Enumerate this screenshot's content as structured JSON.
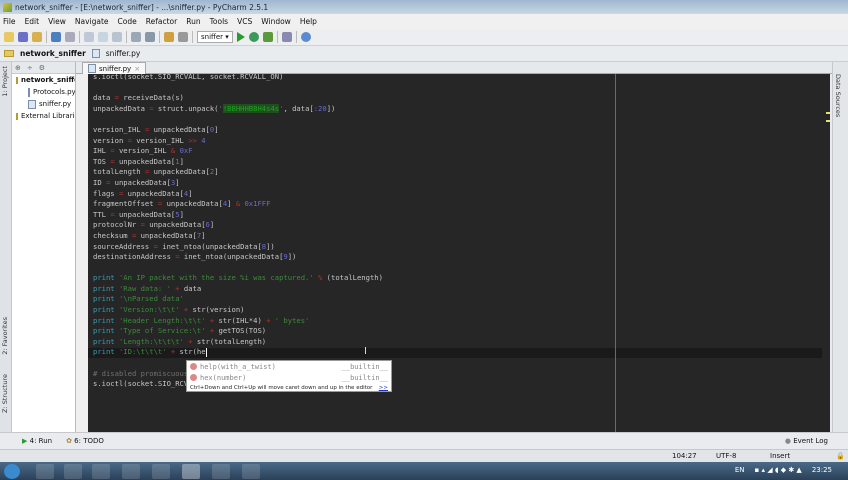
{
  "window": {
    "title": "network_sniffer - [E:\\network_sniffer] - ...\\sniffer.py - PyCharm 2.5.1"
  },
  "menu": [
    "File",
    "Edit",
    "View",
    "Navigate",
    "Code",
    "Refactor",
    "Run",
    "Tools",
    "VCS",
    "Window",
    "Help"
  ],
  "toolbar": {
    "run_config": "sniffer ▾"
  },
  "navbar": {
    "project": "network_sniffer",
    "file": "sniffer.py"
  },
  "left_tabs": {
    "project": "1: Project",
    "favorites": "2: Favorites",
    "structure": "Z: Structure"
  },
  "right_tabs": {
    "data_sources": "Data Sources"
  },
  "project_tree": [
    {
      "label": "network_sniffer",
      "indent": 0
    },
    {
      "label": "Protocols.py",
      "indent": 1
    },
    {
      "label": "sniffer.py",
      "indent": 1
    },
    {
      "label": "External Libraries",
      "indent": 0
    }
  ],
  "editor": {
    "tab": "sniffer.py",
    "current_line": 26,
    "code": [
      [
        [
          "s.ioctl(socket.SIO_RCVALL, socket.RCVALL_ON)",
          ""
        ]
      ],
      [],
      [
        [
          "data ",
          ""
        ],
        [
          "=",
          "op"
        ],
        [
          " receiveData(s)",
          ""
        ]
      ],
      [
        [
          "unpackedData ",
          ""
        ],
        [
          "=",
          "op"
        ],
        [
          " struct.unpack(",
          ""
        ],
        [
          "'",
          "str"
        ],
        [
          "!BBHHHBBH4s4s",
          "fmt"
        ],
        [
          "'",
          "str"
        ],
        [
          ", data[",
          ""
        ],
        [
          ":20",
          "num"
        ],
        [
          "])",
          ""
        ]
      ],
      [],
      [
        [
          "version_IHL ",
          ""
        ],
        [
          "=",
          "op"
        ],
        [
          " unpackedData[",
          ""
        ],
        [
          "0",
          "num"
        ],
        [
          "]",
          ""
        ]
      ],
      [
        [
          "version ",
          ""
        ],
        [
          "=",
          "op"
        ],
        [
          " version_IHL ",
          ""
        ],
        [
          ">>",
          "op"
        ],
        [
          " ",
          ""
        ],
        [
          "4",
          "num"
        ]
      ],
      [
        [
          "IHL ",
          ""
        ],
        [
          "=",
          "op"
        ],
        [
          " version_IHL ",
          ""
        ],
        [
          "&",
          "op"
        ],
        [
          " ",
          ""
        ],
        [
          "0xF",
          "num"
        ]
      ],
      [
        [
          "TOS ",
          ""
        ],
        [
          "=",
          "op"
        ],
        [
          " unpackedData[",
          ""
        ],
        [
          "1",
          "num"
        ],
        [
          "]",
          ""
        ]
      ],
      [
        [
          "totalLength ",
          ""
        ],
        [
          "=",
          "op"
        ],
        [
          " unpackedData[",
          ""
        ],
        [
          "2",
          "num"
        ],
        [
          "]",
          ""
        ]
      ],
      [
        [
          "ID ",
          ""
        ],
        [
          "=",
          "op"
        ],
        [
          " unpackedData[",
          ""
        ],
        [
          "3",
          "num"
        ],
        [
          "]",
          ""
        ]
      ],
      [
        [
          "flags ",
          ""
        ],
        [
          "=",
          "op"
        ],
        [
          " unpackedData[",
          ""
        ],
        [
          "4",
          "num"
        ],
        [
          "]",
          ""
        ]
      ],
      [
        [
          "fragmentOffset ",
          ""
        ],
        [
          "=",
          "op"
        ],
        [
          " unpackedData[",
          ""
        ],
        [
          "4",
          "num"
        ],
        [
          "] ",
          ""
        ],
        [
          "&",
          "op"
        ],
        [
          " ",
          ""
        ],
        [
          "0x1FFF",
          "num"
        ]
      ],
      [
        [
          "TTL ",
          ""
        ],
        [
          "=",
          "op"
        ],
        [
          " unpackedData[",
          ""
        ],
        [
          "5",
          "num"
        ],
        [
          "]",
          ""
        ]
      ],
      [
        [
          "protocolNr ",
          ""
        ],
        [
          "=",
          "op"
        ],
        [
          " unpackedData[",
          ""
        ],
        [
          "6",
          "num"
        ],
        [
          "]",
          ""
        ]
      ],
      [
        [
          "checksum ",
          ""
        ],
        [
          "=",
          "op"
        ],
        [
          " unpackedData[",
          ""
        ],
        [
          "7",
          "num"
        ],
        [
          "]",
          ""
        ]
      ],
      [
        [
          "sourceAddress ",
          ""
        ],
        [
          "=",
          "op"
        ],
        [
          " inet_ntoa(unpackedData[",
          ""
        ],
        [
          "8",
          "num"
        ],
        [
          "])",
          ""
        ]
      ],
      [
        [
          "destinationAddress ",
          ""
        ],
        [
          "=",
          "op"
        ],
        [
          " inet_ntoa(unpackedData[",
          ""
        ],
        [
          "9",
          "num"
        ],
        [
          "])",
          ""
        ]
      ],
      [],
      [
        [
          "print",
          "kw"
        ],
        [
          " 'An IP packet with the size %i was captured.' ",
          "str"
        ],
        [
          "%",
          "op"
        ],
        [
          " (totalLength)",
          ""
        ]
      ],
      [
        [
          "print",
          "kw"
        ],
        [
          " 'Raw data: ' ",
          "str"
        ],
        [
          "+",
          "op"
        ],
        [
          " data",
          ""
        ]
      ],
      [
        [
          "print",
          "kw"
        ],
        [
          " '\\nParsed data'",
          "str"
        ]
      ],
      [
        [
          "print",
          "kw"
        ],
        [
          " 'Version:\\t\\t' ",
          "str"
        ],
        [
          "+",
          "op"
        ],
        [
          " str(version)",
          ""
        ]
      ],
      [
        [
          "print",
          "kw"
        ],
        [
          " 'Header Length:\\t\\t' ",
          "str"
        ],
        [
          "+",
          "op"
        ],
        [
          " str(IHL*4) ",
          ""
        ],
        [
          "+",
          "op"
        ],
        [
          " ' bytes'",
          "str"
        ]
      ],
      [
        [
          "print",
          "kw"
        ],
        [
          " 'Type of Service:\\t' ",
          "str"
        ],
        [
          "+",
          "op"
        ],
        [
          " getTOS(TOS)",
          ""
        ]
      ],
      [
        [
          "print",
          "kw"
        ],
        [
          " 'Length:\\t\\t\\t' ",
          "str"
        ],
        [
          "+",
          "op"
        ],
        [
          " str(totalLength)",
          ""
        ]
      ],
      [
        [
          "print",
          "kw"
        ],
        [
          " 'ID:\\t\\t\\t' ",
          "str"
        ],
        [
          "+",
          "op"
        ],
        [
          " str(he",
          ""
        ]
      ],
      [],
      [
        [
          "# disabled promiscuous mode",
          "cm"
        ]
      ],
      [
        [
          "s.ioctl(socket.SIO_RCVALL, socket.RCVALL_OFF)",
          ""
        ]
      ]
    ]
  },
  "autocomplete": {
    "items": [
      {
        "name": "help(with_a_twist)",
        "source": "__builtin__"
      },
      {
        "name": "hex(number)",
        "source": "__builtin__"
      }
    ],
    "hint": "Ctrl+Down and Ctrl+Up will move caret down and up in the editor",
    "hint_link": ">>"
  },
  "bottom_tabs": {
    "run": "4: Run",
    "todo": "6: TODO",
    "event_log": "Event Log"
  },
  "status": {
    "position": "104:27",
    "encoding": "UTF-8",
    "mode": "Insert"
  },
  "taskbar": {
    "lang": "EN",
    "time": "23:25"
  }
}
